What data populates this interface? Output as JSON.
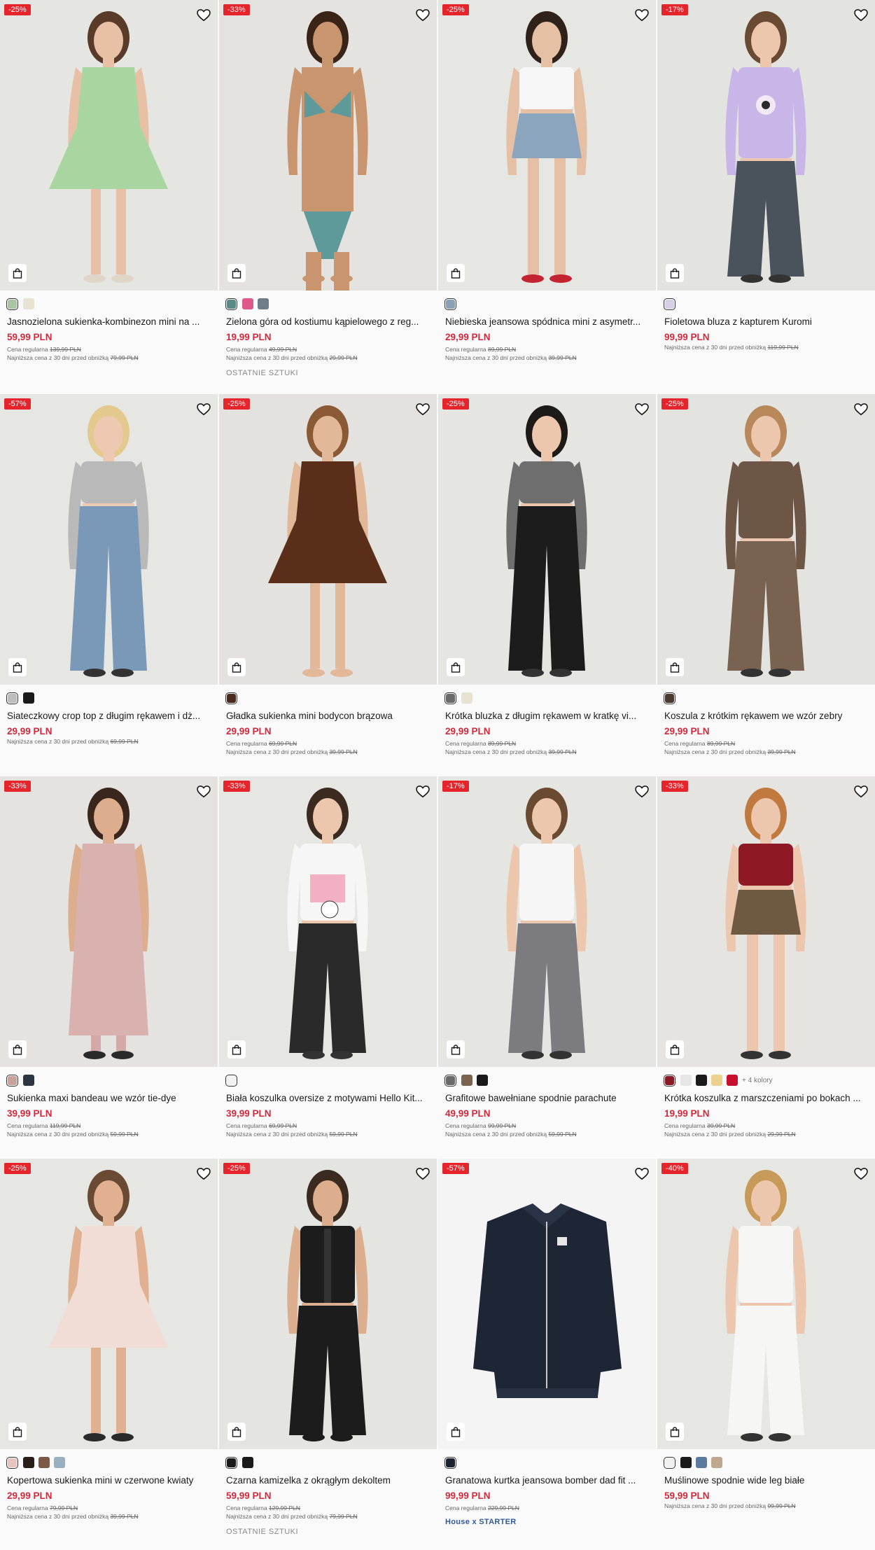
{
  "products": [
    {
      "badge": "-25%",
      "title": "Jasnozielona sukienka-kombinezon mini na ...",
      "price": "59,99 PLN",
      "regular_label": "Cena regularna",
      "regular_price": "139,99 PLN",
      "lowest_label": "Najniższa cena z 30 dni przed obniżką",
      "lowest_price": "79,99 PLN",
      "extra": "",
      "swatches": [
        "#a9c4a0",
        "#e6e3d3"
      ],
      "more_colors": "",
      "photo": {
        "bg": "#e5e5e2",
        "skin": "#e8c0a5",
        "hair": "#5a3a28",
        "top": "#a9d5a0",
        "bottom": "#a9d5a0",
        "legs": "#e8c0a5",
        "shoes": "#e0d6c8",
        "style": "dress"
      }
    },
    {
      "badge": "-33%",
      "title": "Zielona góra od kostiumu kąpielowego z reg...",
      "price": "19,99 PLN",
      "regular_label": "Cena regularna",
      "regular_price": "49,99 PLN",
      "lowest_label": "Najniższa cena z 30 dni przed obniżką",
      "lowest_price": "29,99 PLN",
      "extra": "OSTATNIE SZTUKI",
      "swatches": [
        "#5a8a86",
        "#e0578a",
        "#6d7d8a"
      ],
      "more_colors": "",
      "photo": {
        "bg": "#e4e3e0",
        "skin": "#c9956e",
        "hair": "#3a2418",
        "top": "#5f9a9a",
        "bottom": "#5f9a9a",
        "legs": "#c9956e",
        "shoes": "#c9956e",
        "style": "bikini"
      }
    },
    {
      "badge": "-25%",
      "title": "Niebieska jeansowa spódnica mini z asymetr...",
      "price": "29,99 PLN",
      "regular_label": "Cena regularna",
      "regular_price": "89,99 PLN",
      "lowest_label": "Najniższa cena z 30 dni przed obniżką",
      "lowest_price": "39,99 PLN",
      "extra": "",
      "swatches": [
        "#8aa0b6"
      ],
      "more_colors": "",
      "photo": {
        "bg": "#e6e6e3",
        "skin": "#e6c0a4",
        "hair": "#2e221a",
        "top": "#f7f7f7",
        "bottom": "#8aa5bd",
        "legs": "#e6c0a4",
        "shoes": "#c42430",
        "style": "skirt"
      }
    },
    {
      "badge": "-17%",
      "title": "Fioletowa bluza z kapturem Kuromi",
      "price": "99,99 PLN",
      "regular_label": "",
      "regular_price": "",
      "lowest_label": "Najniższa cena z 30 dni przed obniżką",
      "lowest_price": "119,99 PLN",
      "extra": "",
      "swatches": [
        "#d6d0e6"
      ],
      "more_colors": "",
      "photo": {
        "bg": "#e3e3e0",
        "skin": "#ecc7ad",
        "hair": "#6a4a32",
        "top": "#c9b6e8",
        "bottom": "#4a525c",
        "legs": "#4a525c",
        "shoes": "#333",
        "style": "hoodie"
      }
    },
    {
      "badge": "-57%",
      "title": "Siateczkowy crop top z długim rękawem i dż...",
      "price": "29,99 PLN",
      "regular_label": "",
      "regular_price": "",
      "lowest_label": "Najniższa cena z 30 dni przed obniżką",
      "lowest_price": "69,99 PLN",
      "extra": "",
      "swatches": [
        "#bdbdbd",
        "#1a1a1a"
      ],
      "more_colors": "",
      "photo": {
        "bg": "#e6e6e3",
        "skin": "#ecc9b0",
        "hair": "#e3c98e",
        "top": "#b9b9b9",
        "bottom": "#7a98b8",
        "legs": "#7a98b8",
        "shoes": "#333",
        "style": "crop"
      }
    },
    {
      "badge": "-25%",
      "title": "Gładka sukienka mini bodycon brązowa",
      "price": "29,99 PLN",
      "regular_label": "Cena regularna",
      "regular_price": "69,99 PLN",
      "lowest_label": "Najniższa cena z 30 dni przed obniżką",
      "lowest_price": "39,99 PLN",
      "extra": "",
      "swatches": [
        "#4a2a1c"
      ],
      "more_colors": "",
      "photo": {
        "bg": "#e3e2df",
        "skin": "#e2b898",
        "hair": "#8a5a36",
        "top": "#5a2e18",
        "bottom": "#5a2e18",
        "legs": "#e2b898",
        "shoes": "#e2b898",
        "style": "dress"
      }
    },
    {
      "badge": "-25%",
      "title": "Krótka bluzka z długim rękawem w kratkę vi...",
      "price": "29,99 PLN",
      "regular_label": "Cena regularna",
      "regular_price": "89,99 PLN",
      "lowest_label": "Najniższa cena z 30 dni przed obniżką",
      "lowest_price": "39,99 PLN",
      "extra": "",
      "swatches": [
        "#6a6a6a",
        "#e6e3d3"
      ],
      "more_colors": "",
      "photo": {
        "bg": "#e5e5e2",
        "skin": "#ecc7ad",
        "hair": "#1e1a18",
        "top": "#6e6e6e",
        "bottom": "#1c1c1c",
        "legs": "#ecc7ad",
        "shoes": "#333",
        "style": "crop"
      }
    },
    {
      "badge": "-25%",
      "title": "Koszula z krótkim rękawem we wzór zebry",
      "price": "29,99 PLN",
      "regular_label": "Cena regularna",
      "regular_price": "89,99 PLN",
      "lowest_label": "Najniższa cena z 30 dni przed obniżką",
      "lowest_price": "39,99 PLN",
      "extra": "",
      "swatches": [
        "#4a3a30"
      ],
      "more_colors": "",
      "photo": {
        "bg": "#e3e3e0",
        "skin": "#ecc7ad",
        "hair": "#b8875a",
        "top": "#6e5646",
        "bottom": "#7a6250",
        "legs": "#7a6250",
        "shoes": "#333",
        "style": "shirt"
      }
    },
    {
      "badge": "-33%",
      "title": "Sukienka maxi bandeau we wzór tie-dye",
      "price": "39,99 PLN",
      "regular_label": "Cena regularna",
      "regular_price": "119,99 PLN",
      "lowest_label": "Najniższa cena z 30 dni przed obniżką",
      "lowest_price": "59,99 PLN",
      "extra": "",
      "swatches": [
        "#c9a09a",
        "#2e3440"
      ],
      "more_colors": "",
      "photo": {
        "bg": "#e4e3e0",
        "skin": "#dcae8e",
        "hair": "#3a261c",
        "top": "#d9b2b0",
        "bottom": "#d4aaa8",
        "legs": "#d4aaa8",
        "shoes": "#2a2a2a",
        "style": "maxi"
      }
    },
    {
      "badge": "-33%",
      "title": "Biała koszulka oversize z motywami Hello Kit...",
      "price": "39,99 PLN",
      "regular_label": "Cena regularna",
      "regular_price": "69,99 PLN",
      "lowest_label": "Najniższa cena z 30 dni przed obniżką",
      "lowest_price": "59,99 PLN",
      "extra": "",
      "swatches": [
        "#f2f2f2"
      ],
      "more_colors": "",
      "photo": {
        "bg": "#e6e6e3",
        "skin": "#ecc7ad",
        "hair": "#3a2a20",
        "top": "#f6f6f6",
        "bottom": "#2a2a2a",
        "legs": "#2a2a2a",
        "shoes": "#333",
        "style": "tee"
      }
    },
    {
      "badge": "-17%",
      "title": "Grafitowe bawełniane spodnie parachute",
      "price": "49,99 PLN",
      "regular_label": "Cena regularna",
      "regular_price": "99,99 PLN",
      "lowest_label": "Najniższa cena z 30 dni przed obniżką",
      "lowest_price": "59,99 PLN",
      "extra": "",
      "swatches": [
        "#6a6a6a",
        "#7a6450",
        "#1a1a1a"
      ],
      "more_colors": "",
      "photo": {
        "bg": "#e5e5e2",
        "skin": "#ecc7ad",
        "hair": "#6a4a30",
        "top": "#f6f6f6",
        "bottom": "#7c7c80",
        "legs": "#7c7c80",
        "shoes": "#333",
        "style": "pants"
      }
    },
    {
      "badge": "-33%",
      "title": "Krótka koszulka z marszczeniami po bokach ...",
      "price": "19,99 PLN",
      "regular_label": "Cena regularna",
      "regular_price": "39,99 PLN",
      "lowest_label": "Najniższa cena z 30 dni przed obniżką",
      "lowest_price": "29,99 PLN",
      "extra": "",
      "swatches": [
        "#8a1a24",
        "#e6e6e6",
        "#1a1a1a",
        "#ecd28e",
        "#c8102e"
      ],
      "more_colors": "+ 4 kolory",
      "photo": {
        "bg": "#e5e4e1",
        "skin": "#ecc7ad",
        "hair": "#c07a40",
        "top": "#8e1824",
        "bottom": "#6e5a40",
        "legs": "#ecc7ad",
        "shoes": "#333",
        "style": "skirt"
      }
    },
    {
      "badge": "-25%",
      "title": "Kopertowa sukienka mini w czerwone kwiaty",
      "price": "29,99 PLN",
      "regular_label": "Cena regularna",
      "regular_price": "79,99 PLN",
      "lowest_label": "Najniższa cena z 30 dni przed obniżką",
      "lowest_price": "39,99 PLN",
      "extra": "",
      "swatches": [
        "#e8c4bc",
        "#2a1e1a",
        "#7a5a46",
        "#9ab0c0"
      ],
      "more_colors": "",
      "photo": {
        "bg": "#e6e6e3",
        "skin": "#e0b090",
        "hair": "#6a4a32",
        "top": "#f2dcd6",
        "bottom": "#f2dcd6",
        "legs": "#e0b090",
        "shoes": "#2a2a2a",
        "style": "dress"
      }
    },
    {
      "badge": "-25%",
      "title": "Czarna kamizelka z okrągłym dekoltem",
      "price": "59,99 PLN",
      "regular_label": "Cena regularna",
      "regular_price": "129,99 PLN",
      "lowest_label": "Najniższa cena z 30 dni przed obniżką",
      "lowest_price": "79,99 PLN",
      "extra": "OSTATNIE SZTUKI",
      "swatches": [
        "#1a1a1a",
        "#1a1a1a"
      ],
      "more_colors": "",
      "photo": {
        "bg": "#e4e4e1",
        "skin": "#dcae8e",
        "hair": "#3a2a20",
        "top": "#1c1c1c",
        "bottom": "#1c1c1c",
        "legs": "#1c1c1c",
        "shoes": "#1c1c1c",
        "style": "vest"
      }
    },
    {
      "badge": "-57%",
      "title": "Granatowa kurtka jeansowa bomber dad fit ...",
      "price": "99,99 PLN",
      "regular_label": "Cena regularna",
      "regular_price": "229,99 PLN",
      "lowest_label": "",
      "lowest_price": "",
      "extra": "House x STARTER",
      "swatches": [
        "#1c2230"
      ],
      "more_colors": "",
      "photo": {
        "bg": "#f4f4f4",
        "skin": "#f4f4f4",
        "hair": "#f4f4f4",
        "top": "#1e2636",
        "bottom": "#1e2636",
        "legs": "#f4f4f4",
        "shoes": "#f4f4f4",
        "style": "jacket"
      }
    },
    {
      "badge": "-40%",
      "title": "Muślinowe spodnie wide leg białe",
      "price": "59,99 PLN",
      "regular_label": "",
      "regular_price": "",
      "lowest_label": "Najniższa cena z 30 dni przed obniżką",
      "lowest_price": "99,99 PLN",
      "extra": "",
      "swatches": [
        "#f0f0ee",
        "#1a1a1a",
        "#5a7aa0",
        "#c0a890"
      ],
      "more_colors": "",
      "photo": {
        "bg": "#e6e6e3",
        "skin": "#ecc7ad",
        "hair": "#c89a5a",
        "top": "#f6f6f4",
        "bottom": "#f6f6f4",
        "legs": "#f6f6f4",
        "shoes": "#333",
        "style": "pants"
      }
    }
  ]
}
